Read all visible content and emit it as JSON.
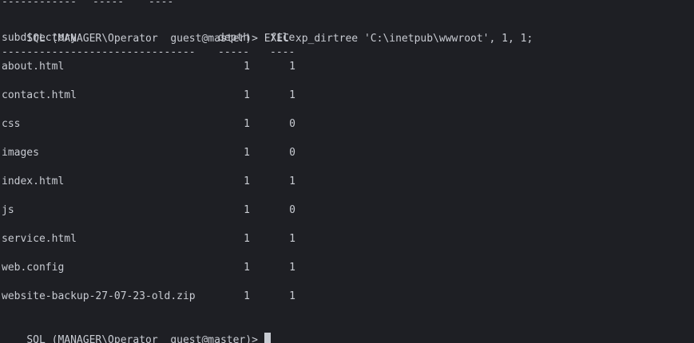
{
  "terminal": {
    "top_partial": {
      "name": "------------",
      "depth": "-----",
      "file": "----"
    },
    "command_line": {
      "prompt": "SQL (MANAGER\\Operator  guest@master)>",
      "command": "EXEC xp_dirtree 'C:\\inetpub\\wwwroot', 1, 1;"
    },
    "table": {
      "headers": {
        "subdirectory": "subdirectory",
        "depth": "depth",
        "file": "file"
      },
      "separators": {
        "subdirectory": "-------------------------------",
        "depth": "-----",
        "file": "----"
      },
      "rows": [
        {
          "subdirectory": "about.html",
          "depth": "1",
          "file": "1"
        },
        {
          "subdirectory": "contact.html",
          "depth": "1",
          "file": "1"
        },
        {
          "subdirectory": "css",
          "depth": "1",
          "file": "0"
        },
        {
          "subdirectory": "images",
          "depth": "1",
          "file": "0"
        },
        {
          "subdirectory": "index.html",
          "depth": "1",
          "file": "1"
        },
        {
          "subdirectory": "js",
          "depth": "1",
          "file": "0"
        },
        {
          "subdirectory": "service.html",
          "depth": "1",
          "file": "1"
        },
        {
          "subdirectory": "web.config",
          "depth": "1",
          "file": "1"
        },
        {
          "subdirectory": "website-backup-27-07-23-old.zip",
          "depth": "1",
          "file": "1"
        }
      ]
    },
    "final_prompt": "SQL (MANAGER\\Operator  guest@master)>"
  },
  "colors": {
    "background": "#1e1f24",
    "foreground": "#c8cbd2"
  }
}
